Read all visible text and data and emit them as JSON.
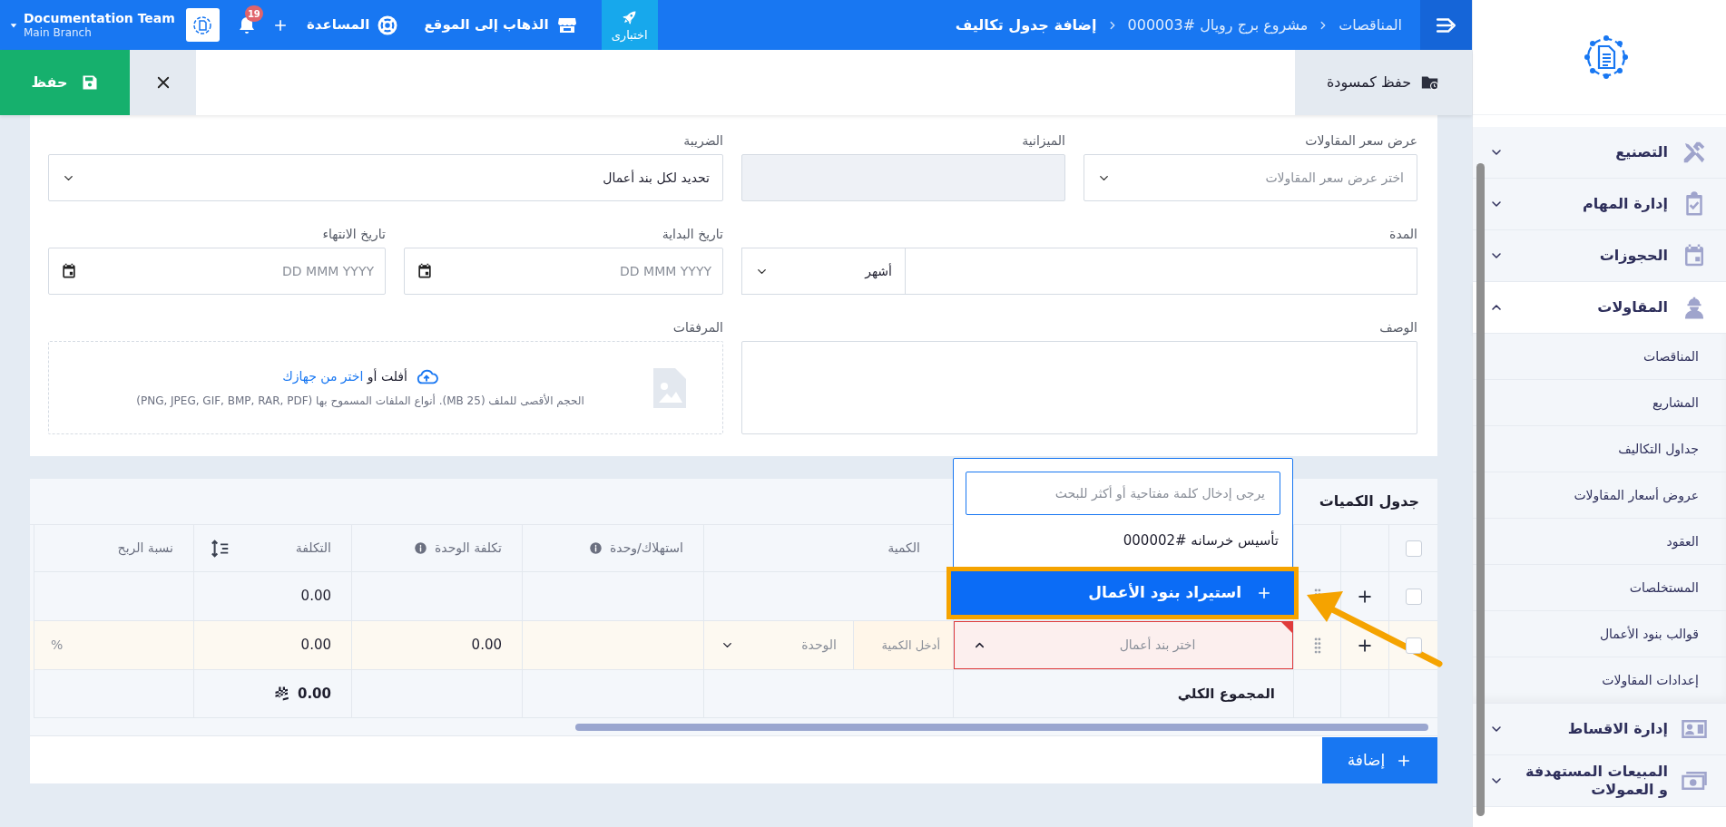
{
  "top_bar": {
    "breadcrumb": [
      {
        "label": "المناقصات",
        "current": false
      },
      {
        "label": "مشروع برج رويال #000003",
        "current": false
      },
      {
        "label": "إضافة جدول تكاليف",
        "current": true
      }
    ],
    "environment_tag": "اختبارى",
    "links": [
      {
        "label": "الذهاب إلى الموقع",
        "kind": "store"
      },
      {
        "label": "المساعدة",
        "kind": "help"
      }
    ],
    "notification_count": "19",
    "account": {
      "name": "Documentation Team",
      "branch": "Main Branch"
    }
  },
  "action_bar": {
    "save_draft": "حفظ كمسودة",
    "save": "حفظ"
  },
  "form": {
    "fields": [
      {
        "kind": "select",
        "label": "عرض سعر المقاولات",
        "placeholder": "اختر عرض سعر المقاولات"
      },
      {
        "kind": "readonly",
        "label": "الميزانية"
      },
      {
        "kind": "select",
        "label": "الضريبة",
        "value": "تحديد لكل بند أعمال"
      },
      {
        "kind": "number_with_unit",
        "label": "المدة",
        "unit": "أشهر"
      },
      {
        "kind": "date",
        "label": "تاريخ البداية",
        "placeholder": "DD MMM YYYY"
      },
      {
        "kind": "date",
        "label": "تاريخ الانتهاء",
        "placeholder": "DD MMM YYYY"
      },
      {
        "kind": "textarea",
        "label": "الوصف"
      },
      {
        "kind": "upload",
        "label": "المرفقات",
        "drop_text": "أفلت أو",
        "browse_link": "اختر من جهازك",
        "hint": "الحجم الأقصى للملف (25 MB). أنواع الملفات المسموح بها (PNG, JPEG, GIF, BMP, RAR, PDF)"
      }
    ]
  },
  "quantities_table": {
    "title": "جدول الكميات",
    "select_all_checked": false,
    "columns": [
      {
        "label": "الكمية",
        "info": false,
        "sortable": false
      },
      {
        "label": "استهلاك/وحدة",
        "info": true,
        "sortable": false
      },
      {
        "label": "تكلفة الوحدة",
        "info": true,
        "sortable": false
      },
      {
        "label": "التكلفة",
        "info": false,
        "sortable": true
      },
      {
        "label": "نسبة الربح",
        "info": false,
        "sortable": false
      }
    ],
    "rows": [
      {
        "kind": "group",
        "checked": false,
        "cost": "0.00"
      },
      {
        "kind": "item",
        "checked": false,
        "item_placeholder": "اختر بند أعمال",
        "item_open": true,
        "invalid": true,
        "quantity_placeholder": "أدخل الكمية",
        "unit_placeholder": "الوحدة",
        "unit_cost": "0.00",
        "cost": "0.00",
        "profit_suffix": "%"
      }
    ],
    "footer": {
      "label": "المجموع الكلي",
      "total_cost": "0.00"
    },
    "dropdown": {
      "search_placeholder": "يرجى إدخال كلمة مفتاحية أو أكثر للبحث",
      "options": [
        "تأسيس خرسانه #000002"
      ],
      "action": {
        "label": "استيراد بنود الأعمال",
        "highlighted": true
      }
    },
    "add_button": "إضافة"
  },
  "sidebar": {
    "items": [
      {
        "label": "التصنيع",
        "expanded": false
      },
      {
        "label": "إدارة المهام",
        "expanded": false
      },
      {
        "label": "الحجوزات",
        "expanded": false
      },
      {
        "label": "المقاولات",
        "expanded": true,
        "children": [
          {
            "label": "المناقصات"
          },
          {
            "label": "المشاريع"
          },
          {
            "label": "جداول التكاليف"
          },
          {
            "label": "عروض أسعار المقاولات"
          },
          {
            "label": "العقود"
          },
          {
            "label": "المستخلصات"
          },
          {
            "label": "قوالب بنود الأعمال"
          },
          {
            "label": "إعدادات المقاولات"
          }
        ]
      },
      {
        "label": "إدارة الاقساط",
        "expanded": false
      },
      {
        "label": "المبيعات المستهدفة و العمولات",
        "expanded": false
      }
    ]
  }
}
